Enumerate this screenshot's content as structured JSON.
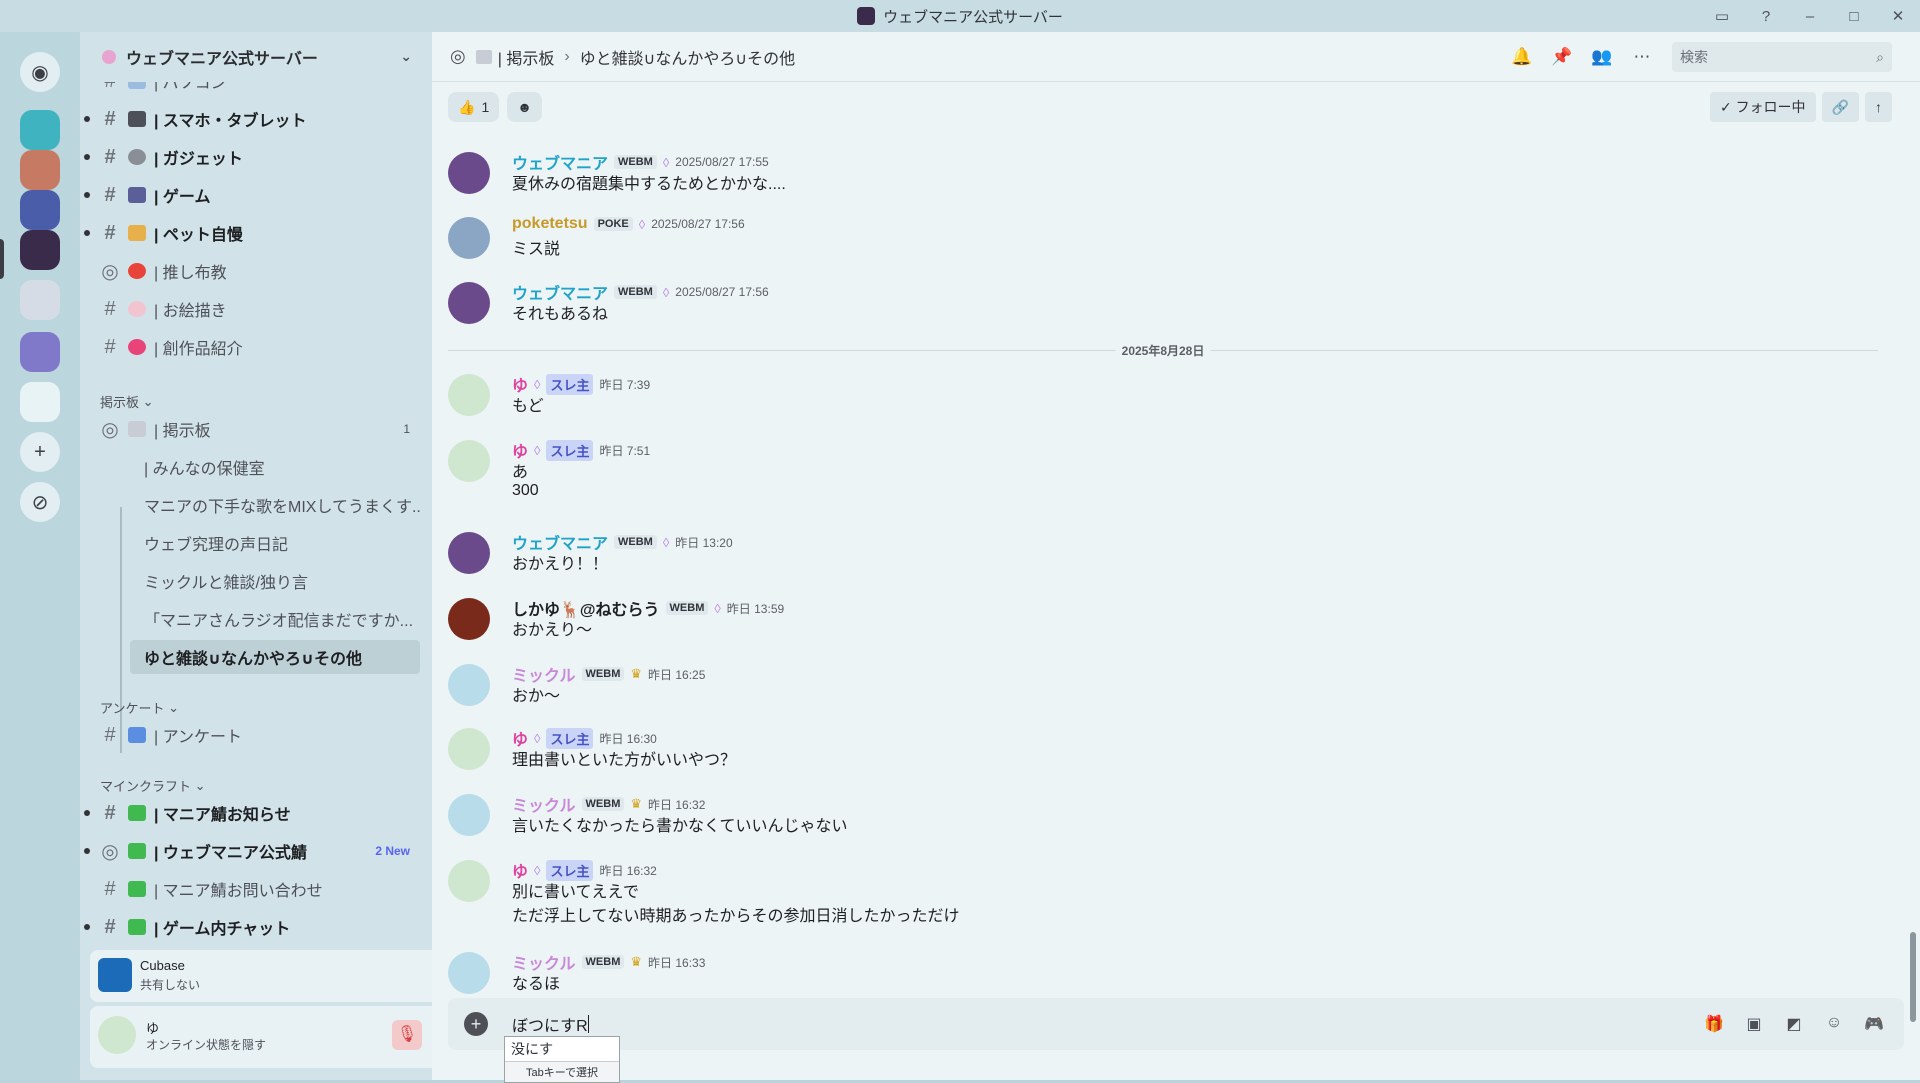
{
  "window": {
    "title": "ウェブマニア公式サーバー"
  },
  "server": {
    "name": "ウェブマニア公式サーバー"
  },
  "channels": [
    {
      "label": "| パソコン",
      "bold": false
    },
    {
      "label": "| スマホ・タブレット",
      "bold": true
    },
    {
      "label": "| ガジェット",
      "bold": true
    },
    {
      "label": "| ゲーム",
      "bold": true
    },
    {
      "label": "| ペット自慢",
      "bold": true
    },
    {
      "label": "| 推し布教",
      "bold": false
    },
    {
      "label": "| お絵描き",
      "bold": false
    },
    {
      "label": "| 創作品紹介",
      "bold": false
    }
  ],
  "category_board": "掲示板",
  "board_channel": {
    "label": "| 掲示板",
    "badge": "1"
  },
  "threads": [
    "| みんなの保健室",
    "マニアの下手な歌をMIXしてうまくす...",
    "ウェブ究理の声日記",
    "ミックルと雑談/独り言",
    "「マニアさんラジオ配信まだですか...",
    "ゆと雑談∪なんかやろ∪その他"
  ],
  "category_survey": "アンケート",
  "survey_channel": "| アンケート",
  "category_minecraft": "マインクラフト",
  "mc_channels": [
    {
      "label": "| マニア鯖お知らせ",
      "bold": true,
      "badge": ""
    },
    {
      "label": "| ウェブマニア公式鯖",
      "bold": true,
      "badge": "2 New"
    },
    {
      "label": "| マニア鯖お問い合わせ",
      "bold": false,
      "badge": ""
    },
    {
      "label": "| ゲーム内チャット",
      "bold": true,
      "badge": ""
    }
  ],
  "activity": {
    "app": "Cubase",
    "status": "共有しない"
  },
  "user": {
    "name": "ゆ",
    "status": "オンライン状態を隠す"
  },
  "topbar": {
    "parent": "| 掲示板",
    "thread": "ゆと雑談∪なんかやろ∪その他",
    "search_placeholder": "検索"
  },
  "reaction": {
    "emoji": "👍",
    "count": "1"
  },
  "follow_label": "フォロー中",
  "date_divider": "2025年8月28日",
  "messages": [
    {
      "user": "ウェブマニア",
      "tag": "WEBM",
      "time": "2025/08/27 17:55",
      "lines": [
        "夏休みの宿題集中するためとかかな...."
      ],
      "color": "#1fa3c9"
    },
    {
      "user": "poketetsu",
      "tag": "POKE",
      "time": "2025/08/27 17:56",
      "lines": [
        "ミス説"
      ],
      "color": "#c79a2a"
    },
    {
      "user": "ウェブマニア",
      "tag": "WEBM",
      "time": "2025/08/27 17:56",
      "lines": [
        "それもあるね"
      ],
      "color": "#1fa3c9"
    },
    {
      "user": "ゆ",
      "tag": "スレ主",
      "time": "昨日 7:39",
      "lines": [
        "もど"
      ],
      "color": "#e040a0"
    },
    {
      "user": "ゆ",
      "tag": "スレ主",
      "time": "昨日 7:51",
      "lines": [
        "あ",
        "300"
      ],
      "color": "#e040a0"
    },
    {
      "user": "ウェブマニア",
      "tag": "WEBM",
      "time": "昨日 13:20",
      "lines": [
        "おかえり！！"
      ],
      "color": "#1fa3c9"
    },
    {
      "user": "しかゆ🦌@ねむらう",
      "tag": "WEBM",
      "time": "昨日 13:59",
      "lines": [
        "おかえり～"
      ],
      "color": "#1e1f22"
    },
    {
      "user": "ミックル",
      "tag": "WEBM",
      "time": "昨日 16:25",
      "lines": [
        "おか～"
      ],
      "color": "#c88ad8"
    },
    {
      "user": "ゆ",
      "tag": "スレ主",
      "time": "昨日 16:30",
      "lines": [
        "理由書いといた方がいいやつ？"
      ],
      "color": "#e040a0"
    },
    {
      "user": "ミックル",
      "tag": "WEBM",
      "time": "昨日 16:32",
      "lines": [
        "言いたくなかったら書かなくていいんじゃない"
      ],
      "color": "#c88ad8"
    },
    {
      "user": "ゆ",
      "tag": "スレ主",
      "time": "昨日 16:32",
      "lines": [
        "別に書いてええで",
        "ただ浮上してない時期あったからその参加日消したかっただけ"
      ],
      "color": "#e040a0"
    },
    {
      "user": "ミックル",
      "tag": "WEBM",
      "time": "昨日 16:33",
      "lines": [
        "なるほ"
      ],
      "color": "#c88ad8"
    }
  ],
  "composer": {
    "text": "ぼつにすR"
  },
  "ime": {
    "candidate": "没にす",
    "hint": "Tabキーで選択"
  }
}
